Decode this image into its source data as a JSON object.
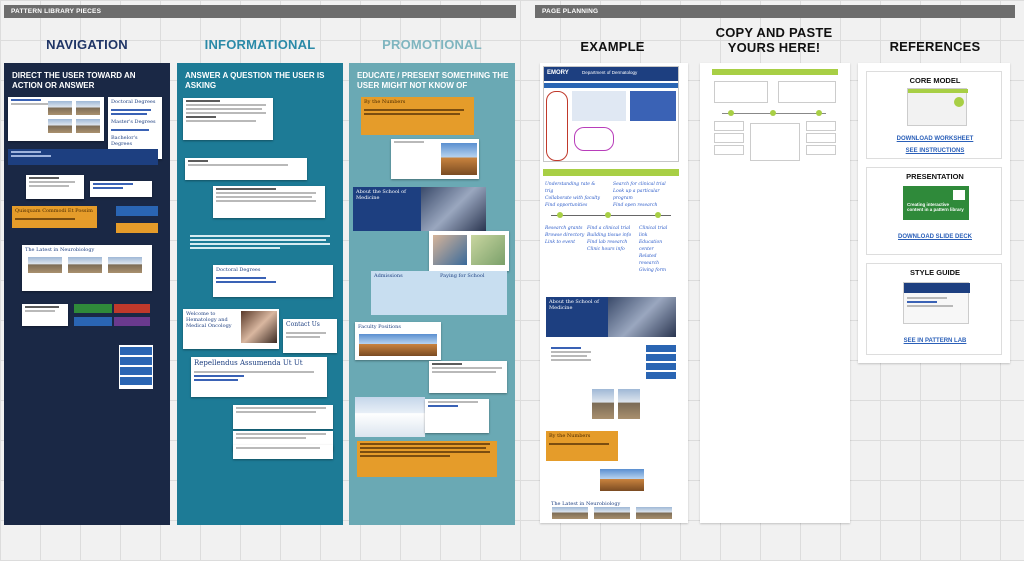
{
  "sections": {
    "library": "PATTERN LIBRARY PIECES",
    "planning": "PAGE PLANNING"
  },
  "columns": {
    "navigation": {
      "title": "NAVIGATION",
      "desc": "DIRECT THE USER TOWARD AN ACTION OR ANSWER",
      "color": "#1a2845"
    },
    "informational": {
      "title": "INFORMATIONAL",
      "desc": "ANSWER A QUESTION THE USER IS ASKING",
      "color": "#1d7b96"
    },
    "promotional": {
      "title": "PROMOTIONAL",
      "desc": "EDUCATE / PRESENT SOMETHING THE USER MIGHT NOT KNOW OF",
      "color": "#6aa9b4"
    }
  },
  "planning": {
    "example": "EXAMPLE",
    "copy": "COPY AND PASTE YOURS HERE!",
    "references": "REFERENCES"
  },
  "references": {
    "core_model": {
      "title": "CORE MODEL",
      "link1": "DOWNLOAD WORKSHEET",
      "link2": "SEE INSTRUCTIONS"
    },
    "presentation": {
      "title": "PRESENTATION",
      "caption": "Creating interactive content in a pattern library",
      "link": "DOWNLOAD SLIDE DECK"
    },
    "style_guide": {
      "title": "STYLE GUIDE",
      "link": "SEE IN PATTERN LAB"
    }
  },
  "snippets": {
    "degrees": "Doctoral Degrees",
    "masters": "Master's Degrees",
    "bachelors": "Bachelor's Degrees",
    "numbers": "By the Numbers",
    "about": "About the School of Medicine",
    "paying": "Paying for School",
    "admissions": "Admissions",
    "contact": "Contact Us",
    "repellendus": "Repellendus Assumenda Ut Ut",
    "welcome": "Welcome to Hematology and Medical Oncology",
    "latest": "The Latest in Neurobiology",
    "faculty": "Faculty Positions",
    "quisquam": "Quisquam Commodi Et Possim",
    "emory": "EMORY",
    "department": "Department of Dermatology"
  },
  "colors": {
    "accent_blue": "#2a5fb8",
    "section_bar": "#6d6d6d",
    "nav_title": "#1f3566",
    "info_title": "#2b8aa8",
    "promo_title": "#7fb5bf"
  }
}
